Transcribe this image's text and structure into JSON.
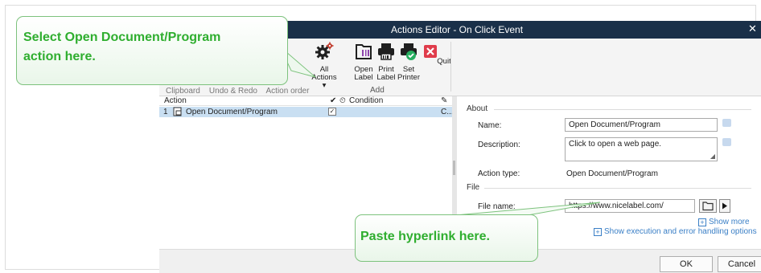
{
  "window": {
    "title": "Actions Editor - On Click Event",
    "close_glyph": "✕"
  },
  "ribbon": {
    "partial_group_labels": "Clipboard    Undo & Redo    Action order",
    "all_actions": {
      "line1": "All",
      "line2": "Actions ▾",
      "icon": "gear-icon"
    },
    "open_label": {
      "line1": "Open",
      "line2": "Label",
      "icon": "folder-icon"
    },
    "print_label": {
      "line1": "Print",
      "line2": "Label",
      "icon": "printer-icon"
    },
    "set_printer": {
      "line1": "Set",
      "line2": "Printer",
      "icon": "printer-check-icon"
    },
    "quit": {
      "label": "Quit",
      "icon": "close-icon"
    },
    "group_add": "Add"
  },
  "action_list": {
    "headers": {
      "action": "Action",
      "condition": "Condition"
    },
    "rows": [
      {
        "index": "1",
        "name": "Open Document/Program",
        "check": "✓",
        "trailing": "C..."
      }
    ]
  },
  "properties": {
    "about_section": "About",
    "name_label": "Name:",
    "name_value": "Open Document/Program",
    "description_label": "Description:",
    "description_value": "Click to open a web page.",
    "action_type_label": "Action type:",
    "action_type_value": "Open Document/Program",
    "file_section": "File",
    "file_name_label": "File name:",
    "file_name_value": "https://www.nicelabel.com/",
    "show_more": "Show more",
    "show_execution": "Show execution and error handling options"
  },
  "footer": {
    "ok": "OK",
    "cancel": "Cancel"
  },
  "callouts": {
    "top_line1": "Select Open Document/Program",
    "top_line2": "action here.",
    "bottom": "Paste hyperlink here."
  },
  "colors": {
    "titlebar": "#1a3049",
    "selection": "#c9dff2",
    "callout_text": "#2fae2f",
    "link": "#3a7fc6"
  }
}
